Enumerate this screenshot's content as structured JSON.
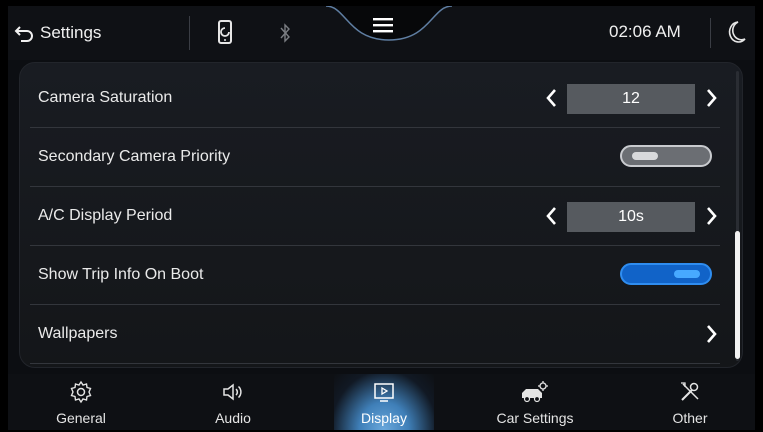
{
  "header": {
    "back_label": "Settings",
    "time": "02:06 AM",
    "icons": [
      "back-arrow-icon",
      "phone-link-icon",
      "bluetooth-icon",
      "menu-icon",
      "night-mode-icon"
    ]
  },
  "settings": {
    "rows": [
      {
        "label": "Camera Saturation",
        "type": "stepper",
        "value": "12"
      },
      {
        "label": "Secondary Camera Priority",
        "type": "toggle",
        "state": "off"
      },
      {
        "label": "A/C Display Period",
        "type": "stepper",
        "value": "10s"
      },
      {
        "label": "Show Trip Info On Boot",
        "type": "toggle",
        "state": "on"
      },
      {
        "label": "Wallpapers",
        "type": "link"
      }
    ]
  },
  "nav": {
    "tabs": [
      {
        "label": "General",
        "icon": "gear-icon"
      },
      {
        "label": "Audio",
        "icon": "speaker-icon"
      },
      {
        "label": "Display",
        "icon": "display-icon",
        "active": true
      },
      {
        "label": "Car Settings",
        "icon": "car-settings-icon"
      },
      {
        "label": "Other",
        "icon": "tools-icon"
      }
    ]
  },
  "colors": {
    "background": "#0c0e12",
    "accent_toggle_on": "#1163c8",
    "active_tab_glow": "#6aa8dc",
    "value_box": "#565a5f"
  }
}
